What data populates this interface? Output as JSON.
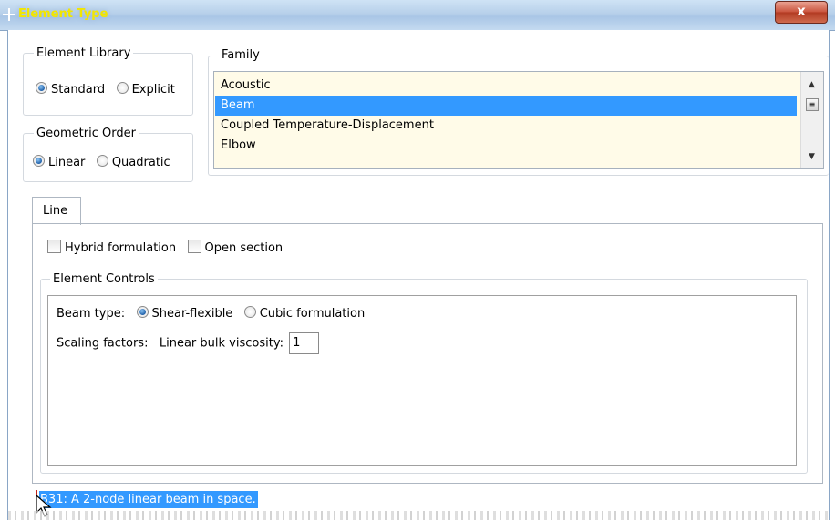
{
  "window": {
    "title": "Element Type",
    "close_glyph": "x"
  },
  "element_library": {
    "label": "Element Library",
    "options": [
      {
        "label": "Standard",
        "selected": true
      },
      {
        "label": "Explicit",
        "selected": false
      }
    ]
  },
  "geometric_order": {
    "label": "Geometric Order",
    "options": [
      {
        "label": "Linear",
        "selected": true
      },
      {
        "label": "Quadratic",
        "selected": false
      }
    ]
  },
  "family": {
    "label": "Family",
    "items": [
      {
        "label": "Acoustic",
        "selected": false
      },
      {
        "label": "Beam",
        "selected": true
      },
      {
        "label": "Coupled Temperature-Displacement",
        "selected": false
      },
      {
        "label": "Elbow",
        "selected": false
      }
    ],
    "selection_color": "#3399ff",
    "background_color": "#fffbe8"
  },
  "tabs": [
    {
      "label": "Line",
      "active": true
    }
  ],
  "options": {
    "hybrid_formulation": {
      "label": "Hybrid formulation",
      "checked": false
    },
    "open_section": {
      "label": "Open section",
      "checked": false
    }
  },
  "element_controls": {
    "label": "Element Controls",
    "beam_type": {
      "label": "Beam type:",
      "options": [
        {
          "label": "Shear-flexible",
          "selected": true
        },
        {
          "label": "Cubic formulation",
          "selected": false
        }
      ]
    },
    "scaling_factors": {
      "label": "Scaling factors:",
      "linear_bulk_viscosity_label": "Linear bulk viscosity:",
      "linear_bulk_viscosity_value": "1"
    }
  },
  "description": "B31:  A 2-node linear beam in space.",
  "icons": {
    "app": "app-cross-icon",
    "close": "close-icon",
    "scroll_up": "scroll-up-icon",
    "scroll_down": "scroll-down-icon",
    "scroll_thumb": "scroll-thumb-icon",
    "pointer": "mouse-pointer-icon"
  }
}
